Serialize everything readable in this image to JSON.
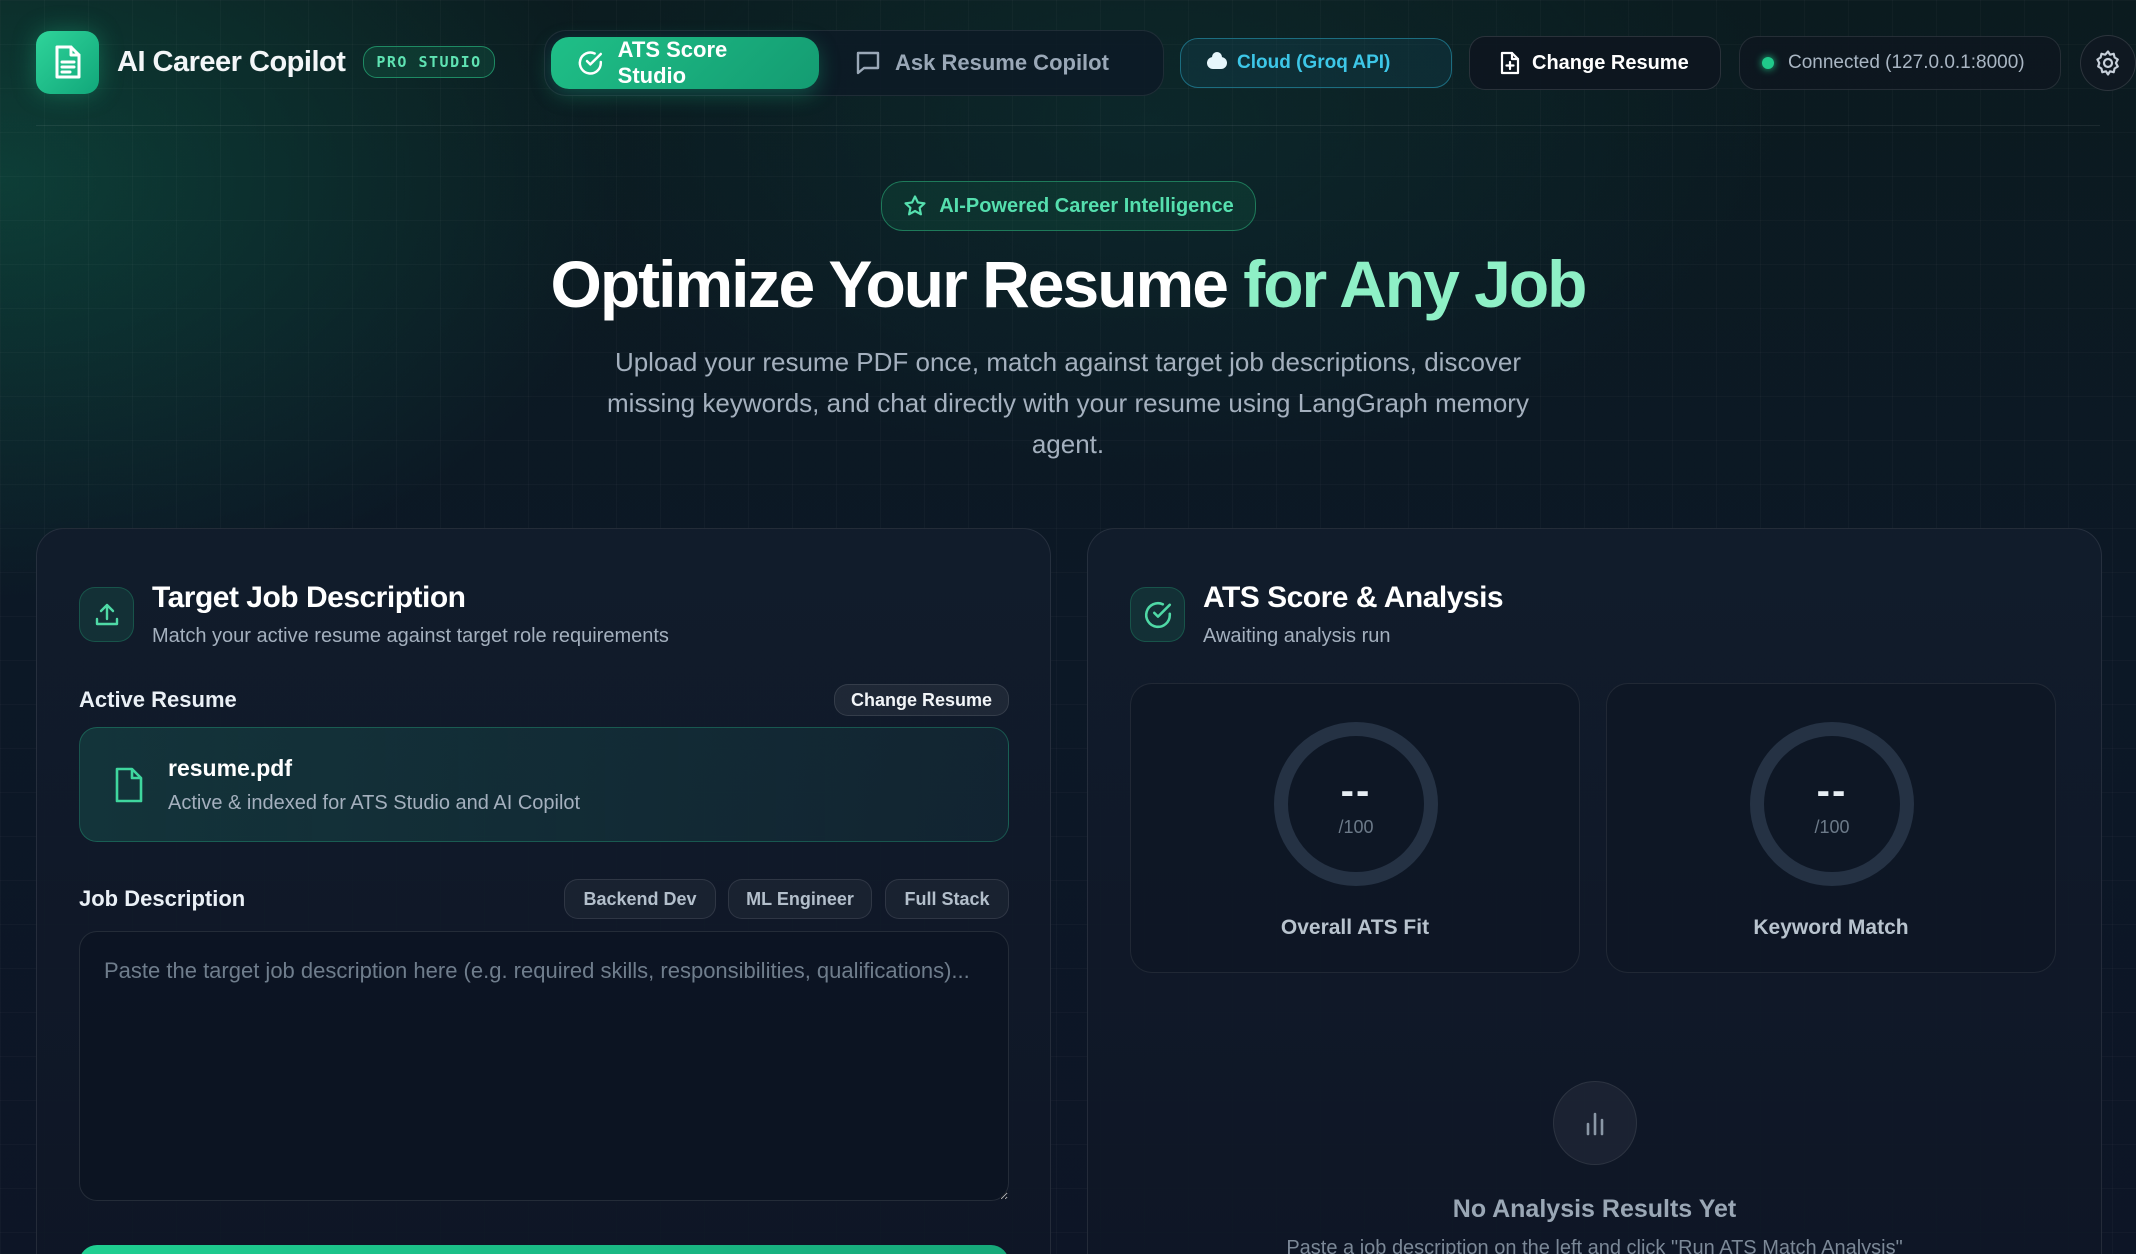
{
  "header": {
    "brand_title": "AI Career Copilot",
    "brand_badge": "PRO STUDIO",
    "tabs": [
      {
        "label": "ATS Score Studio",
        "active": true
      },
      {
        "label": "Ask Resume Copilot",
        "active": false
      }
    ],
    "model_chip": "Cloud (Groq API)",
    "change_resume_label": "Change Resume",
    "connection_status": "Connected (127.0.0.1:8000)"
  },
  "hero": {
    "chip": "AI-Powered Career Intelligence",
    "title_main": "Optimize Your Resume ",
    "title_accent": "for Any Job",
    "subtitle": "Upload your resume PDF once, match against target job descriptions, discover missing keywords, and chat directly with your resume using LangGraph memory agent."
  },
  "left_card": {
    "title": "Target Job Description",
    "subtitle": "Match your active resume against target role requirements",
    "active_resume_label": "Active Resume",
    "change_resume_label": "Change Resume",
    "resume": {
      "name": "resume.pdf",
      "meta": "Active & indexed for ATS Studio and AI Copilot"
    },
    "job_description_label": "Job Description",
    "templates": [
      "Backend Dev",
      "ML Engineer",
      "Full Stack"
    ],
    "jd_value": "",
    "jd_placeholder": "Paste the target job description here (e.g. required skills, responsibilities, qualifications)..."
  },
  "right_card": {
    "title": "ATS Score & Analysis",
    "subtitle": "Awaiting analysis run",
    "scores": [
      {
        "label": "Overall ATS Fit",
        "value": "--",
        "max": "/100"
      },
      {
        "label": "Keyword Match",
        "value": "--",
        "max": "/100"
      }
    ],
    "empty_title": "No Analysis Results Yet",
    "empty_subtitle": "Paste a job description on the left and click \"Run ATS Match Analysis\""
  },
  "colors": {
    "accent": "#1fbf87",
    "accent_light": "#8ef0c6",
    "cloud": "#3dc7e8",
    "status_dot": "#20c98a",
    "background": "#0c1826"
  },
  "icons": {
    "brand": "document-icon",
    "tab_ats": "check-circle-icon",
    "tab_copilot": "chat-bubble-icon",
    "model": "cloud-icon",
    "change_resume": "file-plus-icon",
    "settings": "gear-icon",
    "hero_chip": "star-icon",
    "left_card": "upload-icon",
    "right_card": "check-circle-icon",
    "resume_file": "file-icon",
    "empty_state": "bar-chart-icon"
  }
}
